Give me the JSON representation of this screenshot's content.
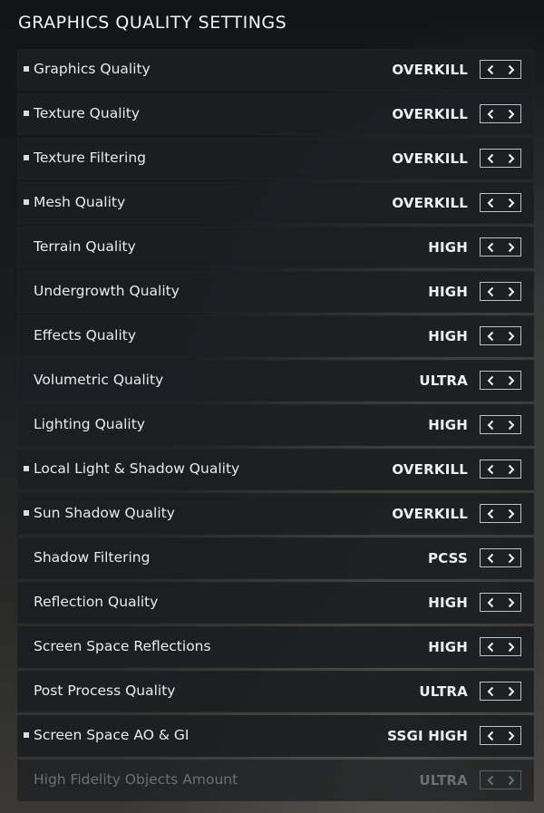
{
  "title": "GRAPHICS QUALITY SETTINGS",
  "icons": {
    "prev": "chevron-left-icon",
    "next": "chevron-right-icon",
    "marker": "square-bullet-icon"
  },
  "settings": [
    {
      "label": "Graphics Quality",
      "value": "OVERKILL",
      "modified": true,
      "disabled": false
    },
    {
      "label": "Texture Quality",
      "value": "OVERKILL",
      "modified": true,
      "disabled": false
    },
    {
      "label": "Texture Filtering",
      "value": "OVERKILL",
      "modified": true,
      "disabled": false
    },
    {
      "label": "Mesh Quality",
      "value": "OVERKILL",
      "modified": true,
      "disabled": false
    },
    {
      "label": "Terrain Quality",
      "value": "HIGH",
      "modified": false,
      "disabled": false
    },
    {
      "label": "Undergrowth Quality",
      "value": "HIGH",
      "modified": false,
      "disabled": false
    },
    {
      "label": "Effects Quality",
      "value": "HIGH",
      "modified": false,
      "disabled": false
    },
    {
      "label": "Volumetric Quality",
      "value": "ULTRA",
      "modified": false,
      "disabled": false
    },
    {
      "label": "Lighting Quality",
      "value": "HIGH",
      "modified": false,
      "disabled": false
    },
    {
      "label": "Local Light & Shadow Quality",
      "value": "OVERKILL",
      "modified": true,
      "disabled": false
    },
    {
      "label": "Sun Shadow Quality",
      "value": "OVERKILL",
      "modified": true,
      "disabled": false
    },
    {
      "label": "Shadow Filtering",
      "value": "PCSS",
      "modified": false,
      "disabled": false
    },
    {
      "label": "Reflection Quality",
      "value": "HIGH",
      "modified": false,
      "disabled": false
    },
    {
      "label": "Screen Space Reflections",
      "value": "HIGH",
      "modified": false,
      "disabled": false
    },
    {
      "label": "Post Process Quality",
      "value": "ULTRA",
      "modified": false,
      "disabled": false
    },
    {
      "label": "Screen Space AO & GI",
      "value": "SSGI HIGH",
      "modified": true,
      "disabled": false
    },
    {
      "label": "High Fidelity Objects Amount",
      "value": "ULTRA",
      "modified": false,
      "disabled": true
    }
  ]
}
